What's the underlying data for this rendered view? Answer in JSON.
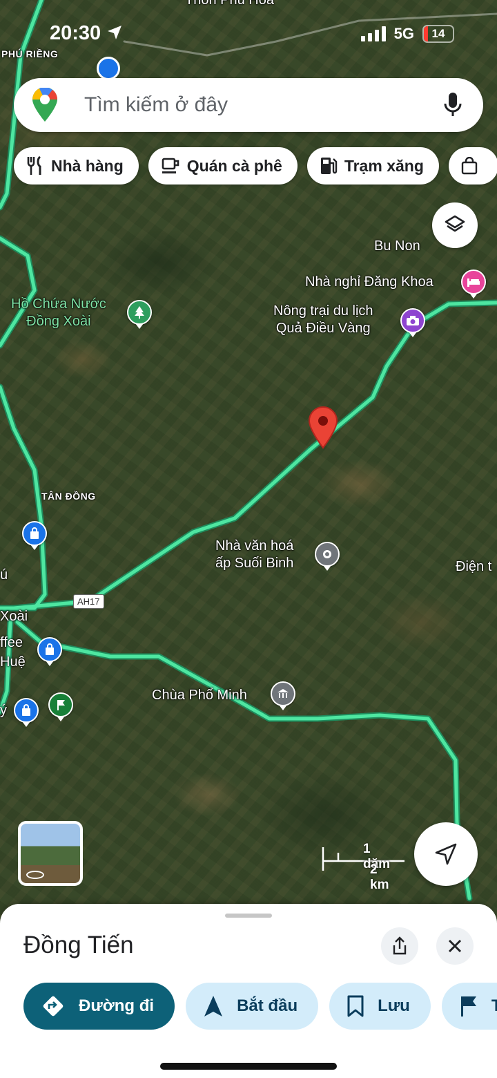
{
  "status_bar": {
    "time": "20:30",
    "network": "5G",
    "battery": "14",
    "battery_level": 0.14
  },
  "search": {
    "placeholder": "Tìm kiếm ở đây"
  },
  "chips": [
    {
      "label": "Nhà hàng",
      "icon": "restaurant-icon"
    },
    {
      "label": "Quán cà phê",
      "icon": "coffee-icon"
    },
    {
      "label": "Trạm xăng",
      "icon": "gas-station-icon"
    },
    {
      "label": "",
      "icon": "shopping-bag-icon"
    }
  ],
  "map": {
    "labels": {
      "phu_rieng": "PHÚ RIỀNG",
      "thon_phu_hoa": "Thôn Phú Hoà",
      "bu_non": "Bu Non",
      "nha_nghi": "Nhà nghỉ Đăng Khoa",
      "nong_trai_1": "Nông trại du lịch",
      "nong_trai_2": "Quả Điều Vàng",
      "ho_chua_1": "Hồ Chứa Nước",
      "ho_chua_2": "Đồng Xoài",
      "tan_dong": "TÂN ĐỒNG",
      "nha_van_hoa_1": "Nhà văn hoá",
      "nha_van_hoa_2": "ấp Suối Binh",
      "dien": "Điện t",
      "xoai": "Xoài",
      "ffee": "ffee",
      "hue": "Huệ",
      "chua": "Chùa Phổ Minh",
      "u": "ú",
      "y": "ý"
    },
    "route_shield": "AH17",
    "scale": {
      "imperial": "1 dặm",
      "metric": "2 km"
    }
  },
  "place": {
    "title": "Đồng Tiến",
    "actions": [
      {
        "label": "Đường đi",
        "icon": "directions-icon"
      },
      {
        "label": "Bắt đầu",
        "icon": "navigation-arrow-icon"
      },
      {
        "label": "Lưu",
        "icon": "bookmark-icon"
      },
      {
        "label": "T",
        "icon": "flag-icon"
      }
    ]
  },
  "colors": {
    "road": "#35d38f",
    "action_primary": "#0d6178",
    "action_secondary": "#d3ecfa",
    "pin": "#ea4335"
  }
}
